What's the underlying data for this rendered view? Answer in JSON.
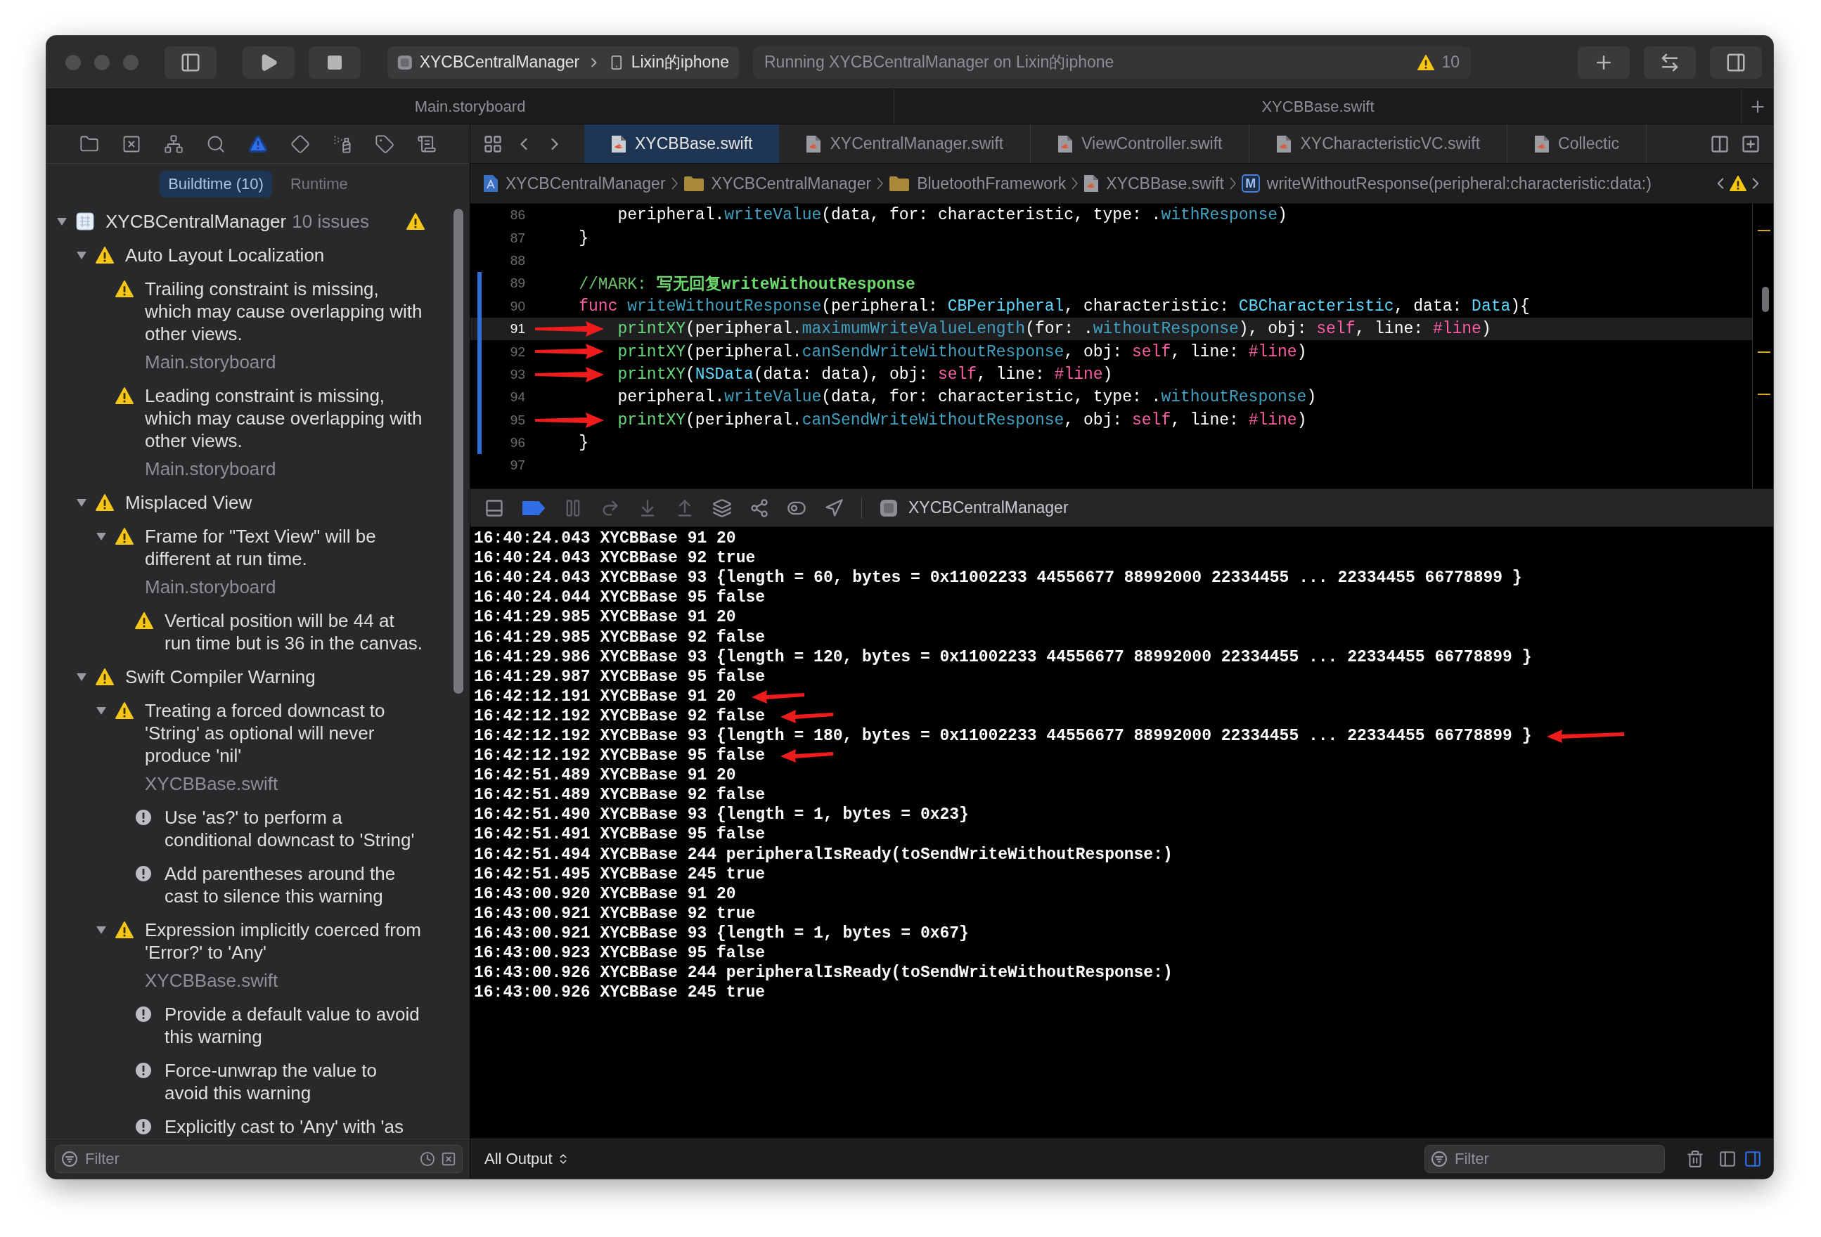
{
  "toolbar": {
    "scheme": "XYCBCentralManager",
    "device": "Lixin的iphone",
    "status": "Running XYCBCentralManager on Lixin的iphone",
    "warning_count": "10"
  },
  "window_tabs": [
    "Main.storyboard",
    "XYCBBase.swift"
  ],
  "navigator": {
    "tabs": [
      {
        "kind": "folder",
        "selected": false
      },
      {
        "kind": "source",
        "selected": false
      },
      {
        "kind": "symbols",
        "selected": false
      },
      {
        "kind": "find",
        "selected": false
      },
      {
        "kind": "issues",
        "selected": true
      },
      {
        "kind": "tests",
        "selected": false
      },
      {
        "kind": "debug",
        "selected": false
      },
      {
        "kind": "breakpoints",
        "selected": false
      },
      {
        "kind": "reports",
        "selected": false
      }
    ],
    "scopes": [
      {
        "label": "Buildtime (10)",
        "selected": true
      },
      {
        "label": "Runtime",
        "selected": false
      }
    ],
    "issues": [
      {
        "kind": "project",
        "text": "XYCBCentralManager",
        "count": "10 issues",
        "expanded": true,
        "children": [
          {
            "kind": "group",
            "text": "Auto Layout Localization",
            "expanded": true,
            "children": [
              {
                "kind": "warning",
                "text": "Trailing constraint is missing, which may cause overlapping with other views.",
                "file": "Main.storyboard"
              },
              {
                "kind": "warning",
                "text": "Leading constraint is missing, which may cause overlapping with other views.",
                "file": "Main.storyboard"
              }
            ]
          },
          {
            "kind": "group",
            "text": "Misplaced View",
            "expanded": true,
            "children": [
              {
                "kind": "warning",
                "text": "Frame for \"Text View\" will be different at run time.",
                "file": "Main.storyboard",
                "expanded": true,
                "children": [
                  {
                    "kind": "warning",
                    "text": "Vertical position will be 44 at run time but is 36 in the canvas."
                  }
                ]
              }
            ]
          },
          {
            "kind": "group",
            "text": "Swift Compiler Warning",
            "expanded": true,
            "children": [
              {
                "kind": "warning",
                "text": "Treating a forced downcast to 'String' as optional will never produce 'nil'",
                "file": "XYCBBase.swift",
                "expanded": true,
                "children": [
                  {
                    "kind": "fixit",
                    "text": "Use 'as?' to perform a conditional downcast to 'String'"
                  },
                  {
                    "kind": "fixit",
                    "text": "Add parentheses around the cast to silence this warning"
                  }
                ]
              },
              {
                "kind": "warning",
                "text": "Expression implicitly coerced from 'Error?' to 'Any'",
                "file": "XYCBBase.swift",
                "expanded": true,
                "children": [
                  {
                    "kind": "fixit",
                    "text": "Provide a default value to avoid this warning"
                  },
                  {
                    "kind": "fixit",
                    "text": "Force-unwrap the value to avoid this warning"
                  },
                  {
                    "kind": "fixit",
                    "text": "Explicitly cast to 'Any' with 'as"
                  }
                ]
              }
            ]
          }
        ]
      }
    ],
    "filter": {
      "placeholder": "Filter"
    }
  },
  "editor": {
    "tabs": [
      {
        "label": "XYCBBase.swift",
        "selected": true
      },
      {
        "label": "XYCentralManager.swift",
        "selected": false
      },
      {
        "label": "ViewController.swift",
        "selected": false
      },
      {
        "label": "XYCharacteristicVC.swift",
        "selected": false
      },
      {
        "label": "Collectic",
        "selected": false
      }
    ],
    "jump_bar": [
      {
        "kind": "project",
        "label": "XYCBCentralManager"
      },
      {
        "kind": "folder",
        "label": "XYCBCentralManager"
      },
      {
        "kind": "folder",
        "label": "BluetoothFramework"
      },
      {
        "kind": "file",
        "label": "XYCBBase.swift"
      },
      {
        "kind": "method",
        "badge": "M",
        "label": "writeWithoutResponse(peripheral:characteristic:data:)"
      }
    ],
    "lines": [
      {
        "number": "86",
        "current": false,
        "changed": false,
        "arrow": false,
        "tokens": [
          {
            "kind": "plain",
            "text": "        peripheral."
          },
          {
            "kind": "member",
            "text": "writeValue"
          },
          {
            "kind": "plain",
            "text": "(data, for: characteristic, type: ."
          },
          {
            "kind": "member",
            "text": "withResponse"
          },
          {
            "kind": "plain",
            "text": ")"
          }
        ]
      },
      {
        "number": "87",
        "current": false,
        "changed": false,
        "arrow": false,
        "tokens": [
          {
            "kind": "plain",
            "text": "    }"
          }
        ]
      },
      {
        "number": "88",
        "current": false,
        "changed": false,
        "arrow": false
      },
      {
        "number": "89",
        "current": false,
        "changed": true,
        "arrow": false,
        "tokens": [
          {
            "kind": "comment",
            "text": "    //MARK: "
          },
          {
            "kind": "mark",
            "text": "写无回复writeWithoutResponse"
          }
        ]
      },
      {
        "number": "90",
        "current": false,
        "changed": true,
        "arrow": false,
        "tokens": [
          {
            "kind": "keyword",
            "text": "    func"
          },
          {
            "kind": "member",
            "text": " writeWithoutResponse"
          },
          {
            "kind": "plain",
            "text": "(peripheral: "
          },
          {
            "kind": "type",
            "text": "CBPeripheral"
          },
          {
            "kind": "plain",
            "text": ", characteristic: "
          },
          {
            "kind": "type",
            "text": "CBCharacteristic"
          },
          {
            "kind": "plain",
            "text": ", data: "
          },
          {
            "kind": "type",
            "text": "Data"
          },
          {
            "kind": "plain",
            "text": "){"
          }
        ]
      },
      {
        "number": "91",
        "current": true,
        "changed": true,
        "arrow": true,
        "tokens": [
          {
            "kind": "call",
            "text": "        printXY"
          },
          {
            "kind": "plain",
            "text": "(peripheral."
          },
          {
            "kind": "member",
            "text": "maximumWriteValueLength"
          },
          {
            "kind": "plain",
            "text": "(for: ."
          },
          {
            "kind": "member",
            "text": "withoutResponse"
          },
          {
            "kind": "plain",
            "text": "), obj: "
          },
          {
            "kind": "keyword",
            "text": "self"
          },
          {
            "kind": "plain",
            "text": ", line: "
          },
          {
            "kind": "keyword",
            "text": "#line"
          },
          {
            "kind": "plain",
            "text": ")"
          }
        ]
      },
      {
        "number": "92",
        "current": false,
        "changed": true,
        "arrow": true,
        "tokens": [
          {
            "kind": "call",
            "text": "        printXY"
          },
          {
            "kind": "plain",
            "text": "(peripheral."
          },
          {
            "kind": "member",
            "text": "canSendWriteWithoutResponse"
          },
          {
            "kind": "plain",
            "text": ", obj: "
          },
          {
            "kind": "keyword",
            "text": "self"
          },
          {
            "kind": "plain",
            "text": ", line: "
          },
          {
            "kind": "keyword",
            "text": "#line"
          },
          {
            "kind": "plain",
            "text": ")"
          }
        ]
      },
      {
        "number": "93",
        "current": false,
        "changed": true,
        "arrow": true,
        "tokens": [
          {
            "kind": "call",
            "text": "        printXY"
          },
          {
            "kind": "plain",
            "text": "("
          },
          {
            "kind": "type",
            "text": "NSData"
          },
          {
            "kind": "plain",
            "text": "(data: data), obj: "
          },
          {
            "kind": "keyword",
            "text": "self"
          },
          {
            "kind": "plain",
            "text": ", line: "
          },
          {
            "kind": "keyword",
            "text": "#line"
          },
          {
            "kind": "plain",
            "text": ")"
          }
        ]
      },
      {
        "number": "94",
        "current": false,
        "changed": true,
        "arrow": false,
        "tokens": [
          {
            "kind": "plain",
            "text": "        peripheral."
          },
          {
            "kind": "member",
            "text": "writeValue"
          },
          {
            "kind": "plain",
            "text": "(data, for: characteristic, type: ."
          },
          {
            "kind": "member",
            "text": "withoutResponse"
          },
          {
            "kind": "plain",
            "text": ")"
          }
        ]
      },
      {
        "number": "95",
        "current": false,
        "changed": true,
        "arrow": true,
        "tokens": [
          {
            "kind": "call",
            "text": "        printXY"
          },
          {
            "kind": "plain",
            "text": "(peripheral."
          },
          {
            "kind": "member",
            "text": "canSendWriteWithoutResponse"
          },
          {
            "kind": "plain",
            "text": ", obj: "
          },
          {
            "kind": "keyword",
            "text": "self"
          },
          {
            "kind": "plain",
            "text": ", line: "
          },
          {
            "kind": "keyword",
            "text": "#line"
          },
          {
            "kind": "plain",
            "text": ")"
          }
        ]
      },
      {
        "number": "96",
        "current": false,
        "changed": true,
        "arrow": false,
        "tokens": [
          {
            "kind": "plain",
            "text": "    }"
          }
        ]
      },
      {
        "number": "97",
        "current": false,
        "changed": false,
        "arrow": false
      }
    ]
  },
  "debug_bar": {
    "breakpoints_active": true,
    "process": "XYCBCentralManager"
  },
  "console": {
    "lines": [
      {
        "text": "16:40:24.043 XYCBBase 91 20",
        "arrow": false
      },
      {
        "text": "16:40:24.043 XYCBBase 92 true",
        "arrow": false
      },
      {
        "text": "16:40:24.043 XYCBBase 93 {length = 60, bytes = 0x11002233 44556677 88992000 22334455 ... 22334455 66778899 }",
        "arrow": false
      },
      {
        "text": "16:40:24.044 XYCBBase 95 false",
        "arrow": false
      },
      {
        "text": "16:41:29.985 XYCBBase 91 20",
        "arrow": false
      },
      {
        "text": "16:41:29.985 XYCBBase 92 false",
        "arrow": false
      },
      {
        "text": "16:41:29.986 XYCBBase 93 {length = 120, bytes = 0x11002233 44556677 88992000 22334455 ... 22334455 66778899 }",
        "arrow": false
      },
      {
        "text": "16:41:29.987 XYCBBase 95 false",
        "arrow": false
      },
      {
        "text": "16:42:12.191 XYCBBase 91 20",
        "arrow": true
      },
      {
        "text": "16:42:12.192 XYCBBase 92 false",
        "arrow": true
      },
      {
        "text": "16:42:12.192 XYCBBase 93 {length = 180, bytes = 0x11002233 44556677 88992000 22334455 ... 22334455 66778899 }",
        "arrow": true
      },
      {
        "text": "16:42:12.192 XYCBBase 95 false",
        "arrow": true
      },
      {
        "text": "16:42:51.489 XYCBBase 91 20",
        "arrow": false
      },
      {
        "text": "16:42:51.489 XYCBBase 92 false",
        "arrow": false
      },
      {
        "text": "16:42:51.490 XYCBBase 93 {length = 1, bytes = 0x23}",
        "arrow": false
      },
      {
        "text": "16:42:51.491 XYCBBase 95 false",
        "arrow": false
      },
      {
        "text": "16:42:51.494 XYCBBase 244 peripheralIsReady(toSendWriteWithoutResponse:)",
        "arrow": false
      },
      {
        "text": "16:42:51.495 XYCBBase 245 true",
        "arrow": false
      },
      {
        "text": "16:43:00.920 XYCBBase 91 20",
        "arrow": false
      },
      {
        "text": "16:43:00.921 XYCBBase 92 true",
        "arrow": false
      },
      {
        "text": "16:43:00.921 XYCBBase 93 {length = 1, bytes = 0x67}",
        "arrow": false
      },
      {
        "text": "16:43:00.923 XYCBBase 95 false",
        "arrow": false
      },
      {
        "text": "16:43:00.926 XYCBBase 244 peripheralIsReady(toSendWriteWithoutResponse:)",
        "arrow": false
      },
      {
        "text": "16:43:00.926 XYCBBase 245 true",
        "arrow": false
      }
    ],
    "output_menu": "All Output",
    "filter": {
      "placeholder": "Filter"
    }
  }
}
